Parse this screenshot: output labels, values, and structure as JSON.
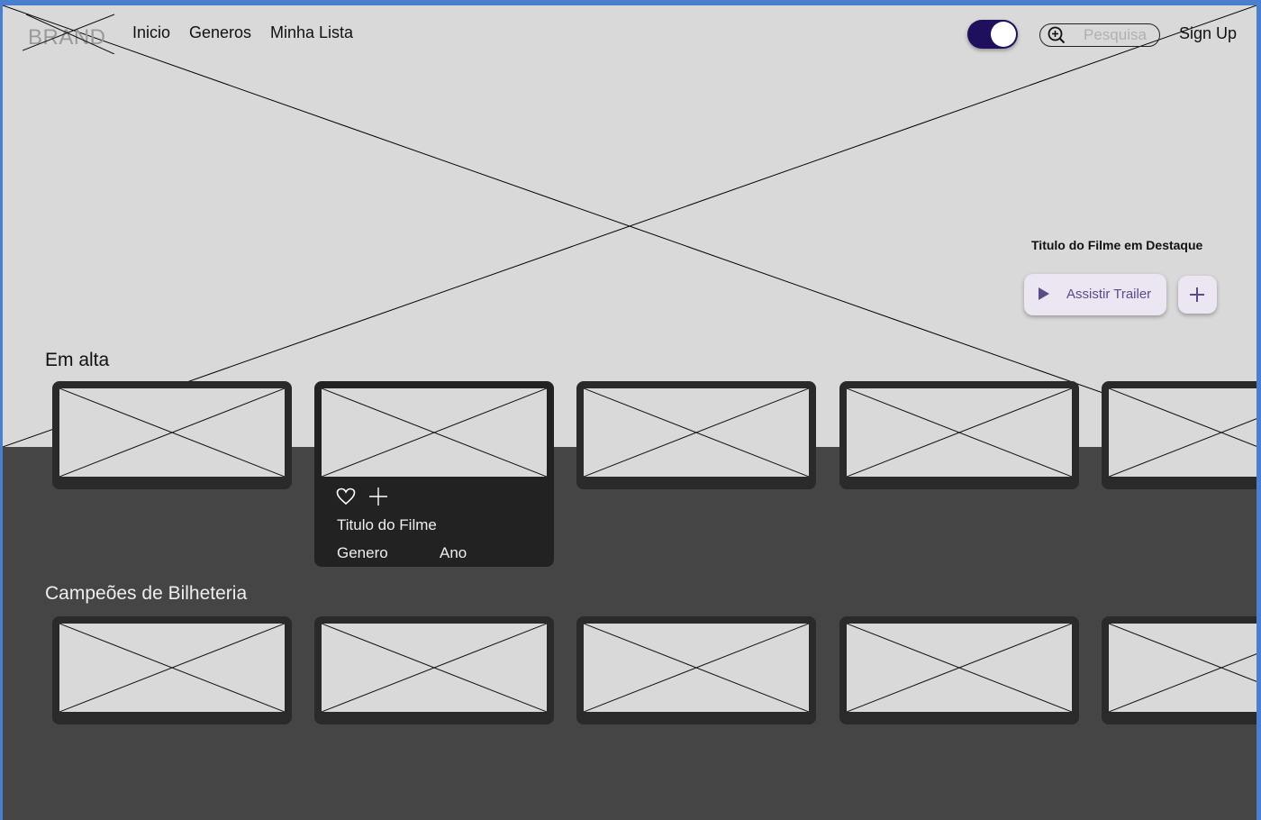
{
  "nav": {
    "brand": "BRAND",
    "links": [
      "Inicio",
      "Generos",
      "Minha Lista"
    ],
    "search_placeholder": "Pesquisa",
    "signup": "Sign Up",
    "toggle_on": true
  },
  "featured": {
    "title": "Titulo do Filme em Destaque",
    "trailer_button": "Assistir Trailer",
    "add_icon": "plus-icon",
    "play_icon": "play-icon"
  },
  "sections": [
    {
      "title": "Em alta"
    },
    {
      "title": "Campeões de Bilheteria"
    }
  ],
  "expanded_card": {
    "title": "Titulo do Filme",
    "genre": "Genero",
    "year": "Ano",
    "icons": [
      "heart-icon",
      "plus-icon"
    ]
  },
  "colors": {
    "hero_bg": "#d9d9d9",
    "lower_bg": "#454545",
    "card_bg": "#2a2a2a",
    "toggle": "#1f0f5c",
    "button_bg": "#ece6f3",
    "button_text": "#5a4a85"
  }
}
